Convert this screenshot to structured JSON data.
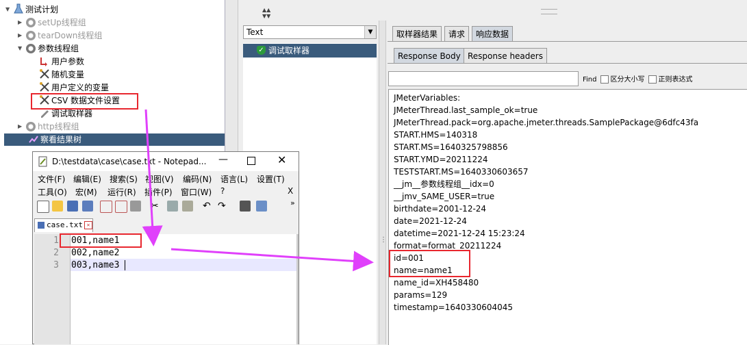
{
  "tree": {
    "root": "测试计划",
    "items": [
      {
        "label": "setUp线程组",
        "dim": true
      },
      {
        "label": "tearDown线程组",
        "dim": true
      },
      {
        "label": "参数线程组"
      },
      {
        "label": "用户参数"
      },
      {
        "label": "随机变量"
      },
      {
        "label": "用户定义的变量"
      },
      {
        "label": "CSV 数据文件设置"
      },
      {
        "label": "调试取样器"
      },
      {
        "label": "http线程组",
        "dim": true
      },
      {
        "label": "察看结果树"
      }
    ]
  },
  "middle": {
    "combo_value": "Text",
    "result_item": "调试取样器"
  },
  "tabs": {
    "top": [
      "取样器结果",
      "请求",
      "响应数据"
    ],
    "sub": [
      "Response Body",
      "Response headers"
    ]
  },
  "find": {
    "label": "Find",
    "case": "区分大小写",
    "regex": "正则表达式"
  },
  "response_lines": [
    "JMeterVariables:",
    "JMeterThread.last_sample_ok=true",
    "JMeterThread.pack=org.apache.jmeter.threads.SamplePackage@6dfc43fa",
    "START.HMS=140318",
    "START.MS=1640325798856",
    "START.YMD=20211224",
    "TESTSTART.MS=1640330603657",
    "__jm__参数线程组__idx=0",
    "__jmv_SAME_USER=true",
    "birthdate=2001-12-24",
    "date=2021-12-24",
    "datetime=2021-12-24 15:23:24",
    "format=format_20211224",
    "id=001",
    "name=name1",
    "name_id=XH458480",
    "params=129",
    "timestamp=1640330604045"
  ],
  "notepad": {
    "title": "D:\\testdata\\case\\case.txt - Notepad...",
    "menu_row1": [
      "文件(F)",
      "编辑(E)",
      "搜索(S)",
      "视图(V)",
      "编码(N)",
      "语言(L)",
      "设置(T)"
    ],
    "menu_row2": [
      "工具(O)",
      "宏(M)",
      "运行(R)",
      "插件(P)",
      "窗口(W)",
      "?"
    ],
    "close_x": "X",
    "tab": "case.txt",
    "lines": [
      {
        "num": "1",
        "text": "001,name1"
      },
      {
        "num": "2",
        "text": "002,name2"
      },
      {
        "num": "3",
        "text": "003,name3"
      }
    ]
  },
  "colors": {
    "selection": "#3a5b7c",
    "annotation_red": "#e8262e",
    "annotation_arrow": "#e040fb"
  }
}
